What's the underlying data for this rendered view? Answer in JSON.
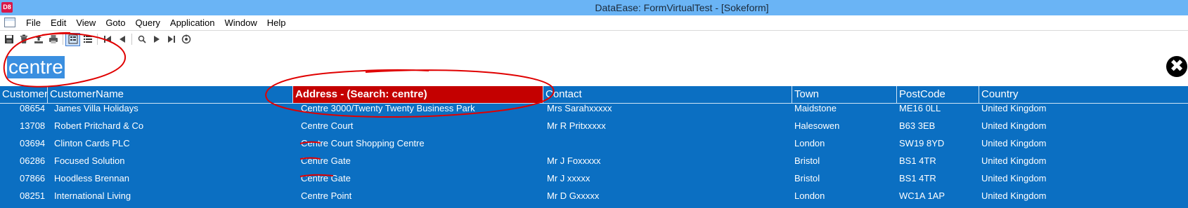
{
  "window": {
    "logo": "D8",
    "title": "DataEase: FormVirtualTest - [Sokeform]"
  },
  "menu": [
    "File",
    "Edit",
    "View",
    "Goto",
    "Query",
    "Application",
    "Window",
    "Help"
  ],
  "toolbar": {
    "buttons": [
      "save-icon",
      "delete-icon",
      "upload-icon",
      "print-icon",
      "form-view-icon",
      "list-view-icon",
      "first-record-icon",
      "previous-record-icon",
      "search-icon",
      "next-record-icon",
      "last-record-icon",
      "refresh-icon"
    ]
  },
  "search": {
    "term": "centre",
    "close_glyph": "✖"
  },
  "grid": {
    "columns": [
      "Customer",
      "CustomerName",
      "Address - (Search: centre)",
      "Contact",
      "Town",
      "PostCode",
      "Country"
    ],
    "active_column": 2,
    "rows": [
      [
        "08654",
        "James Villa Holidays",
        "Centre 3000/Twenty Twenty Business Park",
        "Mrs Sarahxxxxx",
        "Maidstone",
        "ME16 0LL",
        "United Kingdom"
      ],
      [
        "13708",
        "Robert Pritchard & Co",
        "Centre Court",
        "Mr R Pritxxxxx",
        "Halesowen",
        "B63 3EB",
        "United Kingdom"
      ],
      [
        "03694",
        "Clinton Cards PLC",
        "Centre Court Shopping Centre",
        "",
        "London",
        "SW19 8YD",
        "United Kingdom"
      ],
      [
        "06286",
        "Focused Solution",
        "Centre Gate",
        "Mr J Foxxxxx",
        "Bristol",
        "BS1 4TR",
        "United Kingdom"
      ],
      [
        "07866",
        "Hoodless Brennan",
        "Centre Gate",
        "Mr J xxxxx",
        "Bristol",
        "BS1 4TR",
        "United Kingdom"
      ],
      [
        "08251",
        "International Living",
        "Centre Point",
        "Mr D Gxxxxx",
        "London",
        "WC1A 1AP",
        "United Kingdom"
      ]
    ]
  },
  "colors": {
    "titlebar": "#6ab4f5",
    "grid_bg": "#0b6fc2",
    "active_header": "#c40000",
    "search_highlight": "#3a8fe0",
    "annotation": "#e00000"
  }
}
